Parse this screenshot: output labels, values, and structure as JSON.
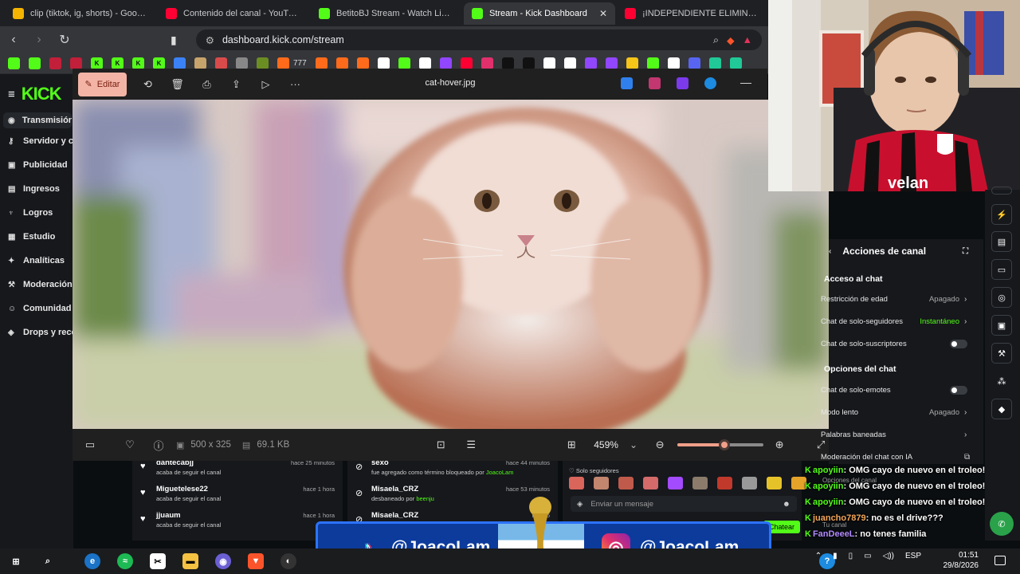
{
  "browser": {
    "tabs": [
      {
        "label": "clip (tiktok, ig, shorts) - Google Drive",
        "color": "#f4b400",
        "active": false
      },
      {
        "label": "Contenido del canal - YouTube Studio",
        "color": "#ff0033",
        "active": false
      },
      {
        "label": "BetitoBJ Stream - Watch Live on Kick",
        "color": "#53fc18",
        "active": false
      },
      {
        "label": "Stream - Kick Dashboard",
        "color": "#53fc18",
        "active": true
      },
      {
        "label": "¡INDEPENDIENTE ELIMINADO",
        "color": "#ff0033",
        "active": false
      }
    ],
    "url": "dashboard.kick.com/stream",
    "bookmarks": [
      {
        "color": "#53fc18",
        "text": ""
      },
      {
        "color": "#53fc18",
        "text": ""
      },
      {
        "color": "#c21f3a",
        "text": ""
      },
      {
        "color": "#c21f3a",
        "text": ""
      },
      {
        "color": "#53fc18",
        "text": "K"
      },
      {
        "color": "#53fc18",
        "text": "K"
      },
      {
        "color": "#53fc18",
        "text": "K"
      },
      {
        "color": "#53fc18",
        "text": "K"
      },
      {
        "color": "#3b82f6",
        "text": ""
      },
      {
        "color": "#c7a46b",
        "text": ""
      },
      {
        "color": "#d94b4b",
        "text": ""
      },
      {
        "color": "#888888",
        "text": ""
      },
      {
        "color": "#6b8e23",
        "text": ""
      },
      {
        "color": "#ff6b1a",
        "text": ""
      },
      {
        "color": "#ff6b1a",
        "text": ""
      },
      {
        "color": "#ff6b1a",
        "text": ""
      },
      {
        "color": "#ff6b1a",
        "text": ""
      },
      {
        "color": "#ffffff",
        "text": ""
      },
      {
        "color": "#53fc18",
        "text": ""
      },
      {
        "color": "#ffffff",
        "text": ""
      },
      {
        "color": "#9146ff",
        "text": ""
      },
      {
        "color": "#ff0033",
        "text": ""
      },
      {
        "color": "#e1306c",
        "text": ""
      },
      {
        "color": "#111111",
        "text": ""
      },
      {
        "color": "#111111",
        "text": ""
      },
      {
        "color": "#ffffff",
        "text": ""
      },
      {
        "color": "#ffffff",
        "text": ""
      },
      {
        "color": "#9146ff",
        "text": ""
      },
      {
        "color": "#9146ff",
        "text": ""
      },
      {
        "color": "#f5c518",
        "text": ""
      },
      {
        "color": "#53fc18",
        "text": ""
      },
      {
        "color": "#ffffff",
        "text": ""
      },
      {
        "color": "#5865f2",
        "text": ""
      },
      {
        "color": "#20c997",
        "text": ""
      },
      {
        "color": "#20c997",
        "text": ""
      }
    ],
    "bookmark_text": "777"
  },
  "kick": {
    "logo": "KICK",
    "sidebar": [
      {
        "label": "Transmisión",
        "icon": "broadcast-icon",
        "active": true
      },
      {
        "label": "Servidor y clave",
        "icon": "key-icon",
        "active": false
      },
      {
        "label": "Publicidad",
        "icon": "ad-icon",
        "active": false
      },
      {
        "label": "Ingresos",
        "icon": "money-icon",
        "active": false
      },
      {
        "label": "Logros",
        "icon": "trophy-icon",
        "active": false
      },
      {
        "label": "Estudio",
        "icon": "studio-icon",
        "active": false
      },
      {
        "label": "Analíticas",
        "icon": "analytics-icon",
        "active": false
      },
      {
        "label": "Moderación",
        "icon": "wrench-icon",
        "active": false
      },
      {
        "label": "Comunidad",
        "icon": "community-icon",
        "active": false
      },
      {
        "label": "Drops y recompensas",
        "icon": "drops-icon",
        "active": false
      }
    ],
    "actions": {
      "title": "Acciones de canal",
      "section1": "Acceso al chat",
      "rows1": [
        {
          "label": "Restricción de edad",
          "value": "Apagado",
          "type": "link"
        },
        {
          "label": "Chat de solo-seguidores",
          "value": "Instantáneo",
          "type": "link-green"
        },
        {
          "label": "Chat de solo-suscriptores",
          "value": "",
          "type": "toggle"
        }
      ],
      "section2": "Opciones del chat",
      "rows2": [
        {
          "label": "Chat de solo-emotes",
          "value": "",
          "type": "toggle"
        },
        {
          "label": "Modo lento",
          "value": "Apagado",
          "type": "link"
        },
        {
          "label": "Palabras baneadas",
          "value": "",
          "type": "link"
        },
        {
          "label": "Moderación del chat con IA",
          "value": "",
          "type": "external"
        }
      ]
    },
    "feed_left": [
      {
        "name": "dantecabjj",
        "sub": "acaba de seguir el canal",
        "time": "hace 25 minutos"
      },
      {
        "name": "Miguetelese22",
        "sub": "acaba de seguir el canal",
        "time": "hace 1 hora"
      },
      {
        "name": "jjuaum",
        "sub": "acaba de seguir el canal",
        "time": "hace 1 hora"
      }
    ],
    "feed_mid": [
      {
        "name": "sexo",
        "sub": "fue agregado como término bloqueado por",
        "by": "JoacoLam",
        "time": "hace 44 minutos"
      },
      {
        "name": "Misaela_CRZ",
        "sub": "desbaneado por",
        "by": "beenju",
        "time": "hace 53 minutos"
      },
      {
        "name": "Misaela_CRZ",
        "sub": "",
        "by": "",
        "time": "hace 5"
      }
    ],
    "chat": {
      "mode_label": "Solo seguidores",
      "placeholder": "Enviar un mensaje",
      "send": "Chatear",
      "emote_colors": [
        "#d9655b",
        "#c2856d",
        "#c05a4a",
        "#d46a6a",
        "#a34bff",
        "#8a7b6b",
        "#c0392b",
        "#999999",
        "#e6c229",
        "#e6a329"
      ]
    }
  },
  "viewer": {
    "title": "cat-hover.jpg",
    "edit_label": "Editar",
    "dimensions": "500 x 325",
    "size": "69.1 KB",
    "zoom": "459%",
    "zoom_fraction": 0.55
  },
  "overlay_chat": [
    {
      "user": "apoyiin",
      "text": ": OMG cayo de nuevo en el troleo!",
      "color": "green"
    },
    {
      "user": "apoyiin",
      "text": ": OMG cayo de nuevo en el troleo!",
      "color": "green"
    },
    {
      "user": "apoyiin",
      "text": ": OMG cayo de nuevo en el troleo!",
      "color": "green"
    },
    {
      "user": "juancho7879",
      "text": ": no es el drive???",
      "color": "orange"
    },
    {
      "user": "FanDeeeL",
      "text": ": no tenes familia",
      "color": "purple"
    }
  ],
  "overlay_ghosts": [
    "Opciones del canal",
    "Tu canal"
  ],
  "banner": {
    "tiktok": "@JoacoLam",
    "instagram": "@JoacoLam"
  },
  "taskbar": {
    "lang": "ESP",
    "time": "01:51",
    "date": "29/8/2026"
  }
}
